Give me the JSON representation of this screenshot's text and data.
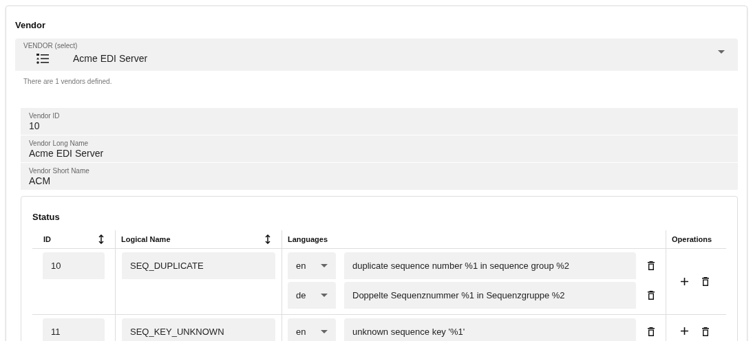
{
  "title": "Vendor",
  "vendor_select": {
    "label": "VENDOR (select)",
    "value": "Acme EDI Server",
    "helper": "There are 1 vendors defined."
  },
  "fields": [
    {
      "label": "Vendor ID",
      "value": "10"
    },
    {
      "label": "Vendor Long Name",
      "value": "Acme EDI Server"
    },
    {
      "label": "Vendor Short Name",
      "value": "ACM"
    }
  ],
  "status": {
    "title": "Status",
    "columns": [
      {
        "label": "ID",
        "sortable": true
      },
      {
        "label": "Logical Name",
        "sortable": true
      },
      {
        "label": "Languages",
        "sortable": false
      },
      {
        "label": "Operations",
        "sortable": false
      }
    ],
    "rows": [
      {
        "id": "10",
        "logical_name": "SEQ_DUPLICATE",
        "languages": [
          {
            "code": "en",
            "text": "duplicate sequence number %1 in sequence group %2"
          },
          {
            "code": "de",
            "text": "Doppelte Sequenznummer %1 in Sequenzgruppe %2"
          }
        ]
      },
      {
        "id": "11",
        "logical_name": "SEQ_KEY_UNKNOWN",
        "languages": [
          {
            "code": "en",
            "text": "unknown sequence key '%1'"
          }
        ]
      }
    ]
  }
}
